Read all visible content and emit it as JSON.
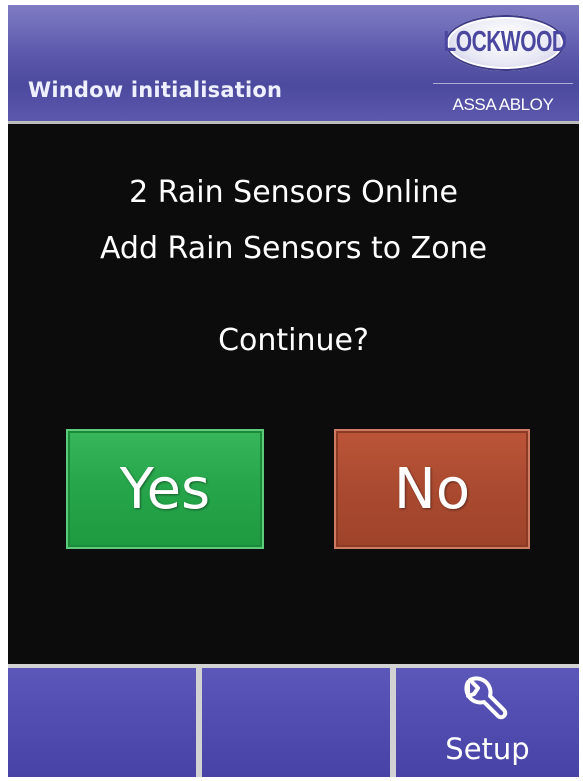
{
  "header": {
    "title": "Window initialisation",
    "logo": {
      "brand": "LOCKWOOD",
      "subtitle": "ASSA ABLOY"
    }
  },
  "dialog": {
    "lines": [
      "2 Rain Sensors Online",
      "Add Rain Sensors to Zone"
    ],
    "prompt": "Continue?",
    "yes_label": "Yes",
    "no_label": "No"
  },
  "footer": {
    "keys": [
      {
        "label": ""
      },
      {
        "label": ""
      },
      {
        "label": "Setup",
        "icon": "wrench-icon"
      }
    ]
  },
  "colors": {
    "header": "#5c59ac",
    "background": "#0c0c0c",
    "yes_button": "#27a64b",
    "no_button": "#aa4a30",
    "soft_key": "#4f4baf"
  }
}
